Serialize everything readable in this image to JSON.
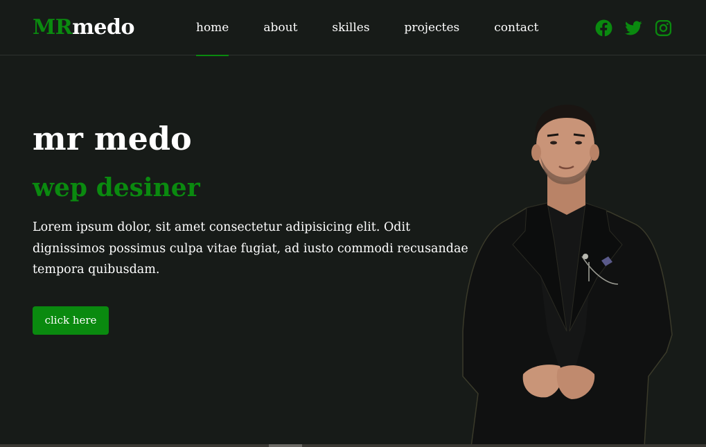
{
  "header": {
    "logo_accent": "MR",
    "logo_rest": "medo",
    "nav": [
      {
        "label": "home",
        "active": true
      },
      {
        "label": "about",
        "active": false
      },
      {
        "label": "skilles",
        "active": false
      },
      {
        "label": "projectes",
        "active": false
      },
      {
        "label": "contact",
        "active": false
      }
    ],
    "socials": [
      {
        "icon": "facebook-icon"
      },
      {
        "icon": "twitter-icon"
      },
      {
        "icon": "instagram-icon"
      }
    ]
  },
  "hero": {
    "title": "mr medo",
    "subtitle": "wep desiner",
    "text": "Lorem ipsum dolor, sit amet consectetur adipisicing elit. Odit dignissimos possimus culpa vitae fugiat, ad iusto commodi recusandae tempora quibusdam.",
    "button_label": "click here"
  },
  "colors": {
    "background": "#171b18",
    "accent": "#0a8a0f",
    "text": "#ffffff"
  }
}
